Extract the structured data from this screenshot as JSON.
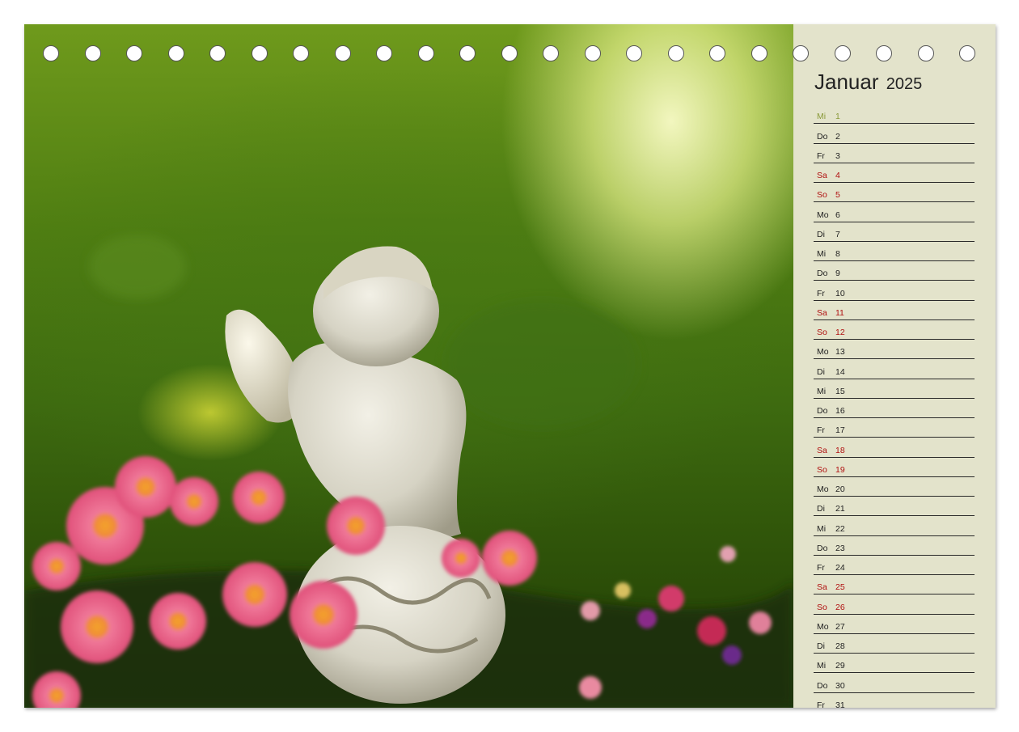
{
  "calendar": {
    "month": "Januar",
    "year": "2025",
    "days": [
      {
        "weekday": "Mi",
        "day": "1",
        "type": "holiday"
      },
      {
        "weekday": "Do",
        "day": "2",
        "type": "normal"
      },
      {
        "weekday": "Fr",
        "day": "3",
        "type": "normal"
      },
      {
        "weekday": "Sa",
        "day": "4",
        "type": "weekend"
      },
      {
        "weekday": "So",
        "day": "5",
        "type": "weekend"
      },
      {
        "weekday": "Mo",
        "day": "6",
        "type": "normal"
      },
      {
        "weekday": "Di",
        "day": "7",
        "type": "normal"
      },
      {
        "weekday": "Mi",
        "day": "8",
        "type": "normal"
      },
      {
        "weekday": "Do",
        "day": "9",
        "type": "normal"
      },
      {
        "weekday": "Fr",
        "day": "10",
        "type": "normal"
      },
      {
        "weekday": "Sa",
        "day": "11",
        "type": "weekend"
      },
      {
        "weekday": "So",
        "day": "12",
        "type": "weekend"
      },
      {
        "weekday": "Mo",
        "day": "13",
        "type": "normal"
      },
      {
        "weekday": "Di",
        "day": "14",
        "type": "normal"
      },
      {
        "weekday": "Mi",
        "day": "15",
        "type": "normal"
      },
      {
        "weekday": "Do",
        "day": "16",
        "type": "normal"
      },
      {
        "weekday": "Fr",
        "day": "17",
        "type": "normal"
      },
      {
        "weekday": "Sa",
        "day": "18",
        "type": "weekend"
      },
      {
        "weekday": "So",
        "day": "19",
        "type": "weekend"
      },
      {
        "weekday": "Mo",
        "day": "20",
        "type": "normal"
      },
      {
        "weekday": "Di",
        "day": "21",
        "type": "normal"
      },
      {
        "weekday": "Mi",
        "day": "22",
        "type": "normal"
      },
      {
        "weekday": "Do",
        "day": "23",
        "type": "normal"
      },
      {
        "weekday": "Fr",
        "day": "24",
        "type": "normal"
      },
      {
        "weekday": "Sa",
        "day": "25",
        "type": "weekend"
      },
      {
        "weekday": "So",
        "day": "26",
        "type": "weekend"
      },
      {
        "weekday": "Mo",
        "day": "27",
        "type": "normal"
      },
      {
        "weekday": "Di",
        "day": "28",
        "type": "normal"
      },
      {
        "weekday": "Mi",
        "day": "29",
        "type": "normal"
      },
      {
        "weekday": "Do",
        "day": "30",
        "type": "normal"
      },
      {
        "weekday": "Fr",
        "day": "31",
        "type": "normal"
      }
    ]
  },
  "photo": {
    "subject": "angel-figurine-icon"
  },
  "binding": {
    "ring_icon": "binder-ring-icon"
  },
  "colors": {
    "panel_background": "#e3e3cb",
    "weekend_text": "#b01010",
    "holiday_text": "#8a9a3a",
    "normal_text": "#222222"
  }
}
